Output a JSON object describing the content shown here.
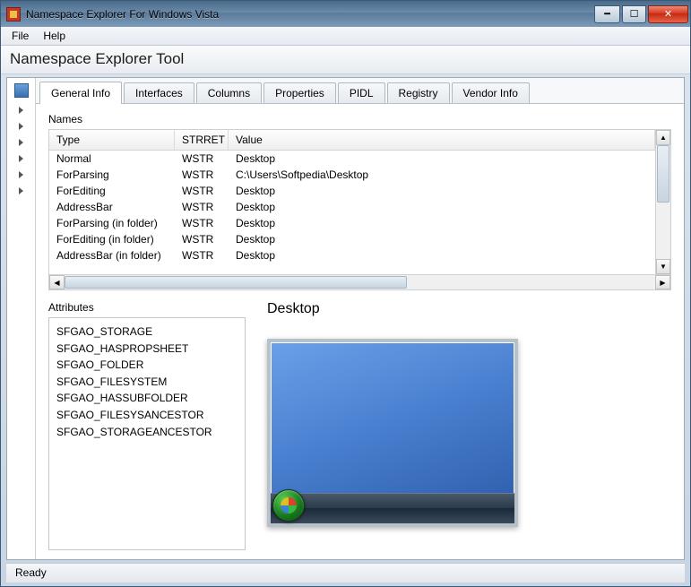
{
  "window": {
    "title": "Namespace Explorer For Windows Vista"
  },
  "menu": {
    "file": "File",
    "help": "Help"
  },
  "tool_title": "Namespace Explorer Tool",
  "tabs": [
    "General Info",
    "Interfaces",
    "Columns",
    "Properties",
    "PIDL",
    "Registry",
    "Vendor Info"
  ],
  "active_tab": 0,
  "names_label": "Names",
  "names_columns": {
    "type": "Type",
    "strret": "STRRET",
    "value": "Value"
  },
  "names_rows": [
    {
      "type": "Normal",
      "strret": "WSTR",
      "value": "Desktop"
    },
    {
      "type": "ForParsing",
      "strret": "WSTR",
      "value": "C:\\Users\\Softpedia\\Desktop"
    },
    {
      "type": "ForEditing",
      "strret": "WSTR",
      "value": "Desktop"
    },
    {
      "type": "AddressBar",
      "strret": "WSTR",
      "value": "Desktop"
    },
    {
      "type": "ForParsing (in folder)",
      "strret": "WSTR",
      "value": "Desktop"
    },
    {
      "type": "ForEditing (in folder)",
      "strret": "WSTR",
      "value": "Desktop"
    },
    {
      "type": "AddressBar (in folder)",
      "strret": "WSTR",
      "value": "Desktop"
    }
  ],
  "attributes_label": "Attributes",
  "attributes": [
    "SFGAO_STORAGE",
    "SFGAO_HASPROPSHEET",
    "SFGAO_FOLDER",
    "SFGAO_FILESYSTEM",
    "SFGAO_HASSUBFOLDER",
    "SFGAO_FILESYSANCESTOR",
    "SFGAO_STORAGEANCESTOR"
  ],
  "preview_title": "Desktop",
  "status": "Ready"
}
